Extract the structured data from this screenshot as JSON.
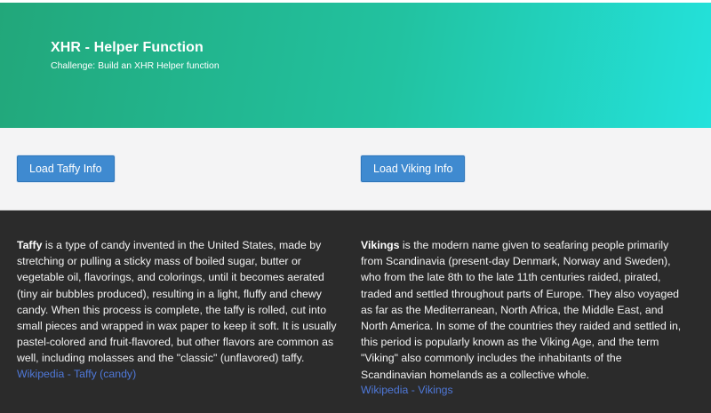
{
  "header": {
    "title": "XHR - Helper Function",
    "subtitle": "Challenge: Build an XHR Helper function"
  },
  "buttons": {
    "taffy_label": "Load Taffy Info",
    "viking_label": "Load Viking Info"
  },
  "taffy": {
    "term": "Taffy",
    "body": " is a type of candy invented in the United States, made by stretching or pulling a sticky mass of boiled sugar, butter or vegetable oil, flavorings, and colorings, until it becomes aerated (tiny air bubbles produced), resulting in a light, fluffy and chewy candy. When this process is complete, the taffy is rolled, cut into small pieces and wrapped in wax paper to keep it soft. It is usually pastel-colored and fruit-flavored, but other flavors are common as well, including molasses and the \"classic\" (unflavored) taffy.",
    "link_text": "Wikipedia - Taffy (candy)"
  },
  "vikings": {
    "term": "Vikings",
    "body": " is the modern name given to seafaring people primarily from Scandinavia (present-day Denmark, Norway and Sweden), who from the late 8th to the late 11th centuries raided, pirated, traded and settled throughout parts of Europe. They also voyaged as far as the Mediterranean, North Africa, the Middle East, and North America. In some of the countries they raided and settled in, this period is popularly known as the Viking Age, and the term \"Viking\" also commonly includes the inhabitants of the Scandinavian homelands as a collective whole.",
    "link_text": "Wikipedia - Vikings"
  },
  "colors": {
    "hero_gradient_start": "#22a77a",
    "hero_gradient_end": "#23e2dc",
    "button_blue": "#3f8ad0",
    "content_bg": "#2b2b2b",
    "link_blue": "#4f78d8"
  }
}
